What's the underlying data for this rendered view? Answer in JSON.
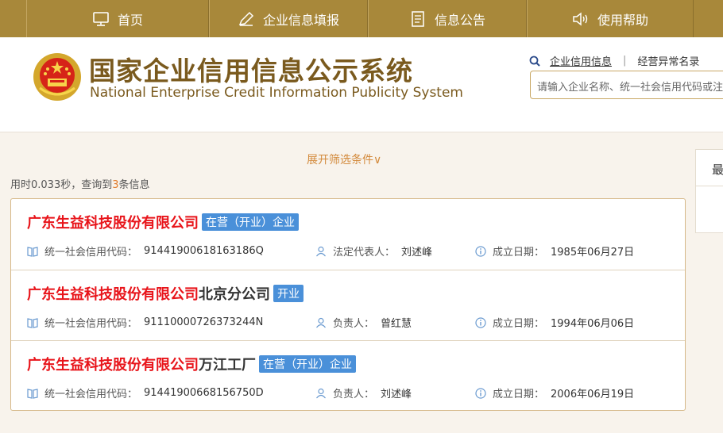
{
  "nav": {
    "items": [
      {
        "label": "首页",
        "icon": "monitor-icon"
      },
      {
        "label": "企业信息填报",
        "icon": "edit-pen-icon"
      },
      {
        "label": "信息公告",
        "icon": "document-icon"
      },
      {
        "label": "使用帮助",
        "icon": "speaker-icon"
      }
    ]
  },
  "header": {
    "title_cn": "国家企业信用信息公示系统",
    "title_en": "National Enterprise Credit Information Publicity System",
    "links": {
      "credit_info": "企业信用信息",
      "sep": "|",
      "abnormal_list": "经营异常名录"
    },
    "search": {
      "placeholder": "请输入企业名称、统一社会信用代码或注册号"
    }
  },
  "filter": {
    "toggle_label": "展开筛选条件∨"
  },
  "stats": {
    "prefix": "用时0.033秒，查询到",
    "count": "3",
    "suffix": "条信息"
  },
  "side_panel": {
    "head": "最"
  },
  "results": [
    {
      "name_highlight": "广东生益科技股份有限公司",
      "name_rest": "",
      "status": "在营（开业）企业",
      "code_label": "统一社会信用代码：",
      "code": "91441900618163186Q",
      "person_label": "法定代表人：",
      "person": "刘述峰",
      "date_label": "成立日期：",
      "date": "1985年06月27日"
    },
    {
      "name_highlight": "广东生益科技股份有限公司",
      "name_rest": "北京分公司",
      "status": "开业",
      "code_label": "统一社会信用代码：",
      "code": "91110000726373244N",
      "person_label": "负责人：",
      "person": "曾红慧",
      "date_label": "成立日期：",
      "date": "1994年06月06日"
    },
    {
      "name_highlight": "广东生益科技股份有限公司",
      "name_rest": "万江工厂",
      "status": "在营（开业）企业",
      "code_label": "统一社会信用代码：",
      "code": "91441900668156750D",
      "person_label": "负责人：",
      "person": "刘述峰",
      "date_label": "成立日期：",
      "date": "2006年06月19日"
    }
  ],
  "colors": {
    "nav_bg": "#a8883a",
    "brand_text": "#7a5a1e",
    "highlight_red": "#e8141a",
    "status_blue": "#4a90d9",
    "accent_orange": "#e07a2a"
  }
}
